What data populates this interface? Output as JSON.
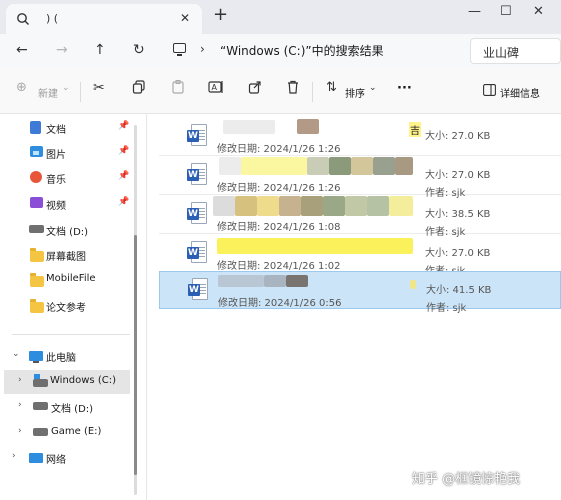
{
  "tab": {
    "title": ") (",
    "close": "✕"
  },
  "window_controls": {
    "minimize": "—",
    "maximize": "☐",
    "close": "✕"
  },
  "address": {
    "crumb": "“Windows (C:)”中的搜索结果",
    "search_value": "业山碑"
  },
  "toolbar": {
    "new_label": "新建",
    "sort_label": "排序",
    "details_label": "详细信息",
    "more": "···"
  },
  "sidebar": {
    "quick": [
      {
        "label": "文档",
        "icon": "documents-icon",
        "pinned": true
      },
      {
        "label": "图片",
        "icon": "pictures-icon",
        "pinned": true
      },
      {
        "label": "音乐",
        "icon": "music-icon",
        "pinned": true
      },
      {
        "label": "视频",
        "icon": "videos-icon",
        "pinned": true
      },
      {
        "label": "文档 (D:)",
        "icon": "drive-icon",
        "pinned": false
      },
      {
        "label": "屏幕截图",
        "icon": "folder-icon",
        "pinned": false
      },
      {
        "label": "MobileFile",
        "icon": "folder-icon",
        "pinned": false
      },
      {
        "label": "论文参考",
        "icon": "folder-icon",
        "pinned": false
      }
    ],
    "this_pc": "此电脑",
    "drives": [
      "Windows (C:)",
      "文档 (D:)",
      "Game (E:)"
    ],
    "network": "网络"
  },
  "results": [
    {
      "name": "",
      "date": "修改日期: 2024/1/26 1:26",
      "size": "大小: 27.0 KB",
      "author": "",
      "highlight": "吉"
    },
    {
      "name": "",
      "date": "修改日期: 2024/1/26 1:26",
      "size": "大小: 27.0 KB",
      "author": "作者: sjk",
      "highlight": ""
    },
    {
      "name": "",
      "date": "修改日期: 2024/1/26 1:08",
      "size": "大小: 38.5 KB",
      "author": "作者: sjk",
      "highlight": ""
    },
    {
      "name": "",
      "date": "修改日期: 2024/1/26 1:02",
      "size": "大小: 27.0 KB",
      "author": "作者: sjk",
      "highlight": ""
    },
    {
      "name": "",
      "date": "修改日期: 2024/1/26 0:56",
      "size": "大小: 41.5 KB",
      "author": "作者: sjk",
      "highlight": ""
    }
  ],
  "watermark": "知乎 @框镜惊艳我"
}
